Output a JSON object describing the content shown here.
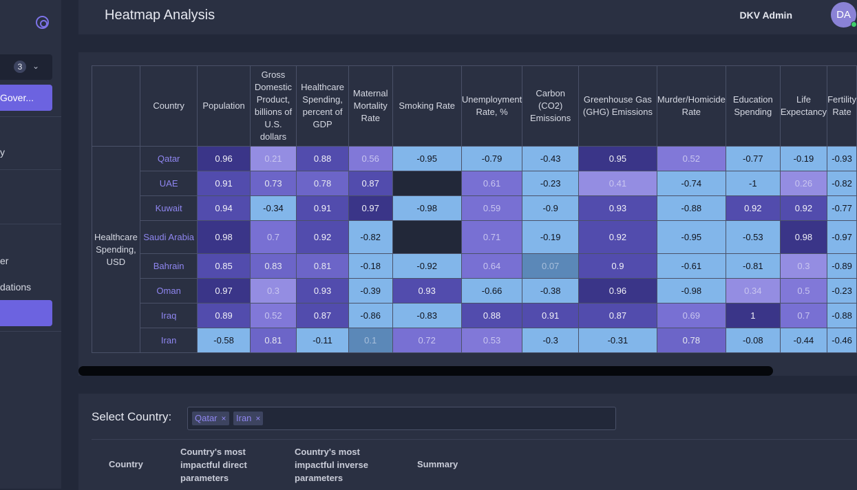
{
  "sidebar": {
    "filter_count": "3",
    "gov_button_label": "Gover...",
    "items": [
      "y",
      "er",
      "dations"
    ]
  },
  "header": {
    "title": "Heatmap Analysis",
    "user_name": "DKV Admin",
    "avatar_initials": "DA"
  },
  "heatmap": {
    "row_group": "Healthcare Spending, USD",
    "columns": [
      "Country",
      "Population",
      "Gross Domestic Product, billions of U.S. dollars",
      "Healthcare Spending, percent of GDP",
      "Maternal Mortality Rate",
      "Smoking Rate",
      "Unemployment Rate, %",
      "Carbon (CO2) Emissions",
      "Greenhouse Gas (GHG) Emissions",
      "Murder/Homicide Rate",
      "Education Spending",
      "Life Expectancy",
      "Fertility Rate"
    ],
    "rows": [
      {
        "country": "Qatar",
        "values": [
          "0.96",
          "0.21",
          "0.88",
          "0.56",
          "-0.95",
          "-0.79",
          "-0.43",
          "0.95",
          "0.52",
          "-0.77",
          "-0.19",
          "-0.93"
        ]
      },
      {
        "country": "UAE",
        "values": [
          "0.91",
          "0.73",
          "0.78",
          "0.87",
          "",
          "0.61",
          "-0.23",
          "0.41",
          "-0.74",
          "-1",
          "0.26",
          "-0.82"
        ]
      },
      {
        "country": "Kuwait",
        "values": [
          "0.94",
          "-0.34",
          "0.91",
          "0.97",
          "-0.98",
          "0.59",
          "-0.9",
          "0.93",
          "-0.88",
          "0.92",
          "0.92",
          "-0.77"
        ]
      },
      {
        "country": "Saudi Arabia",
        "values": [
          "0.98",
          "0.7",
          "0.92",
          "-0.82",
          "",
          "0.71",
          "-0.19",
          "0.92",
          "-0.95",
          "-0.53",
          "0.98",
          "-0.97"
        ]
      },
      {
        "country": "Bahrain",
        "values": [
          "0.85",
          "0.83",
          "0.81",
          "-0.18",
          "-0.92",
          "0.64",
          "0.07",
          "0.9",
          "-0.61",
          "-0.81",
          "0.3",
          "-0.89"
        ]
      },
      {
        "country": "Oman",
        "values": [
          "0.97",
          "0.3",
          "0.93",
          "-0.39",
          "0.93",
          "-0.66",
          "-0.38",
          "0.96",
          "-0.98",
          "0.34",
          "0.5",
          "-0.23"
        ]
      },
      {
        "country": "Iraq",
        "values": [
          "0.89",
          "0.52",
          "0.87",
          "-0.86",
          "-0.83",
          "0.88",
          "0.91",
          "0.87",
          "0.69",
          "1",
          "0.7",
          "-0.88"
        ]
      },
      {
        "country": "Iran",
        "values": [
          "-0.58",
          "0.81",
          "-0.11",
          "0.1",
          "0.72",
          "0.53",
          "-0.3",
          "-0.31",
          "0.78",
          "-0.08",
          "-0.44",
          "-0.46"
        ]
      }
    ]
  },
  "selector": {
    "label": "Select Country:",
    "chips": [
      "Qatar",
      "Iran"
    ],
    "remove_glyph": "×"
  },
  "summary_table": {
    "headers": [
      "Country",
      "Country's most impactful direct parameters",
      "Country's most impactful inverse parameters",
      "Summary"
    ]
  }
}
